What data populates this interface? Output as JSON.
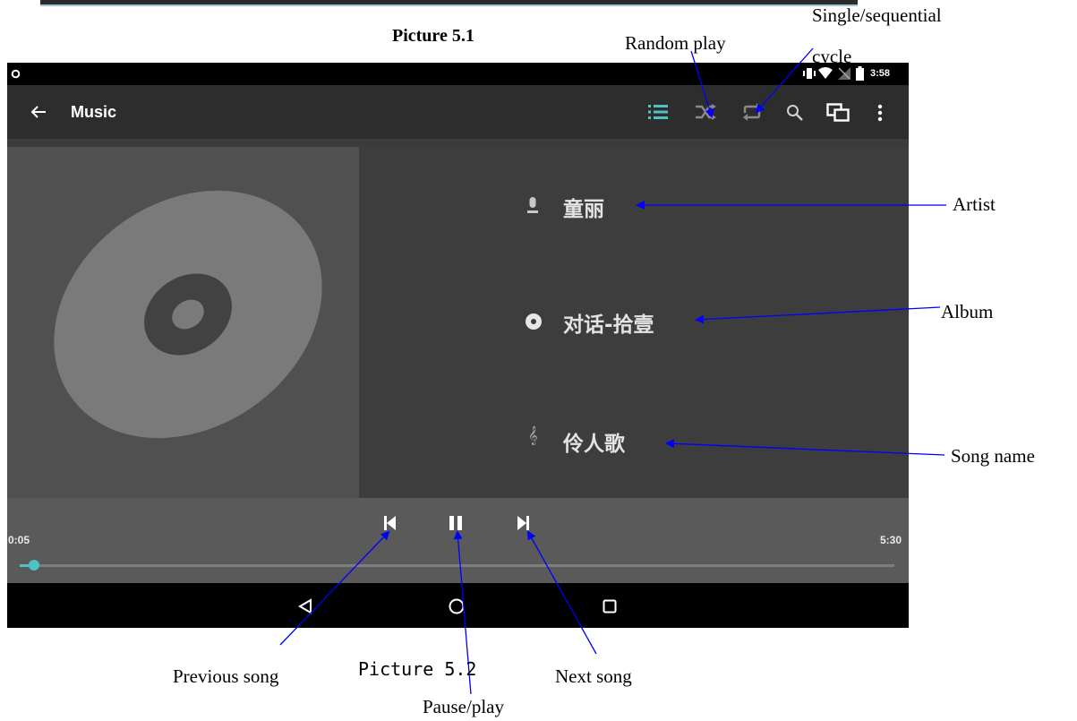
{
  "captions": {
    "picture_top": "Picture 5.1",
    "picture_bottom": "Picture 5.2"
  },
  "status_bar": {
    "time": "3:58"
  },
  "app_bar": {
    "title": "Music"
  },
  "track": {
    "artist": "童丽",
    "album": "对话-拾壹",
    "song": "伶人歌"
  },
  "playback": {
    "elapsed": "0:05",
    "total": "5:30",
    "progress_fraction": 0.016
  },
  "annotations": {
    "random_play": "Random play",
    "single_sequential_line1": "Single/sequential",
    "single_sequential_line2": "cycle",
    "artist": "Artist",
    "album": "Album",
    "song_name": "Song name",
    "previous_song": "Previous song",
    "pause_play": "Pause/play",
    "next_song": "Next song"
  },
  "colors": {
    "accent": "#4dc3c3",
    "annotation_arrow": "#0000ff"
  }
}
